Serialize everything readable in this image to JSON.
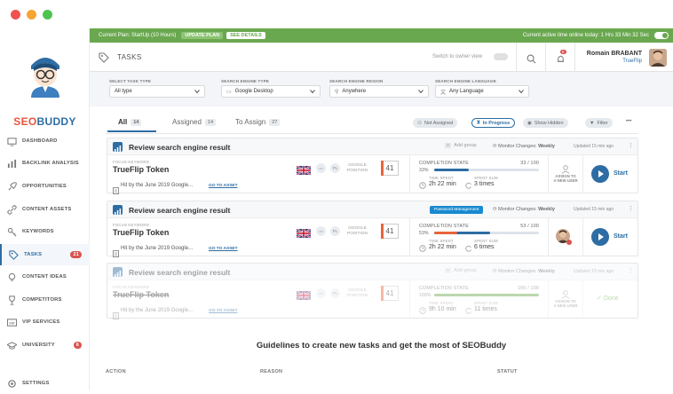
{
  "colors": {
    "accent": "#2d6da3",
    "green": "#6aa84f",
    "red": "#d9534f",
    "orange": "#e8643a"
  },
  "topbar": {
    "plan": "Current Plan: StartUp (10 Hours)",
    "update": "UPDATE PLAN",
    "details": "SEE DETAILS",
    "active": "Current active time online today: 1 Hrs 33 Min 32 Sec"
  },
  "logo": {
    "seo": "SEO",
    "buddy": "BUDDY"
  },
  "sidebar": {
    "items": [
      {
        "label": "DASHBOARD",
        "icon": "monitor-icon"
      },
      {
        "label": "BACKLINK ANALYSIS",
        "icon": "chart-icon"
      },
      {
        "label": "OPPORTUNITIES",
        "icon": "rocket-icon"
      },
      {
        "label": "CONTENT ASSETS",
        "icon": "link-icon"
      },
      {
        "label": "KEYWORDS",
        "icon": "key-icon"
      },
      {
        "label": "TASKS",
        "icon": "tag-icon",
        "badge": "21"
      },
      {
        "label": "CONTENT IDEAS",
        "icon": "bulb-icon"
      },
      {
        "label": "COMPETITORS",
        "icon": "trophy-icon"
      },
      {
        "label": "VIP SERVICES",
        "icon": "vip-icon"
      },
      {
        "label": "UNIVERSITY",
        "icon": "graduation-icon",
        "badge": "6"
      }
    ],
    "settings": "SETTINGS"
  },
  "header": {
    "title": "TASKS",
    "switch": "Switch to owner view",
    "bell_count": "5",
    "user_name": "Romain BRABANT",
    "user_company": "TrueFlip"
  },
  "filters": [
    {
      "label": "SELECT TASK TYPE",
      "value": "All type"
    },
    {
      "label": "SEARCH ENGINE TYPE",
      "value": "Google Desktop"
    },
    {
      "label": "SEARCH ENGINE REGION",
      "value": "Anywhere"
    },
    {
      "label": "SEARCH ENGINE LANGUAGE",
      "value": "Any Language"
    }
  ],
  "tabs": [
    {
      "label": "All",
      "count": "14"
    },
    {
      "label": "Assigned",
      "count": "14"
    },
    {
      "label": "To Assign",
      "count": "27"
    }
  ],
  "pills": {
    "not_assigned": "Not Assigned",
    "in_progress": "In Progress",
    "show_hidden": "Show Hidden",
    "filter": "Filter",
    "more": "•••"
  },
  "common": {
    "focus": "FOCUS KEYWORD",
    "gpos": "GOOGLE",
    "gpos2": "POSITION",
    "completion": "COMPLETION STATE",
    "time_spent": "TIME SPENT",
    "spent_sum": "SPENT SUM",
    "goto": "GO TO ASSET",
    "assign1": "ASSIGN TO",
    "assign2": "A NEW USER",
    "monitor": "Monitor Changes:",
    "weekly": "Weekly",
    "start": "Start",
    "done": "Done",
    "add_group": "Add group",
    "flag_pl": "PL"
  },
  "tasks": [
    {
      "title": "Review search engine result",
      "keyword": "TrueFlip Token",
      "hit": "Hit by the June 2019 Google...",
      "position": "41",
      "progress": "33 / 100",
      "pct": "33%",
      "pct_val": 0.33,
      "time": "2h 22 min",
      "count": "3 times",
      "updated": "Updated 15 min ago",
      "badge": ""
    },
    {
      "title": "Review search engine result",
      "keyword": "TrueFlip Token",
      "hit": "Hit by the June 2019 Google...",
      "position": "41",
      "progress": "53 / 100",
      "pct": "53%",
      "pct_val": 0.53,
      "time": "2h 22 min",
      "count": "6 times",
      "updated": "Updated 15 min ago",
      "badge": "Password Management"
    },
    {
      "title": "Review search engine result",
      "keyword": "TrueFlip Token",
      "hit": "Hit by the June 2019 Google...",
      "position": "41",
      "progress": "100 / 100",
      "pct": "100%",
      "pct_val": 1.0,
      "time": "9h 10 min",
      "count": "11 times",
      "updated": "Updated 15 min ago",
      "badge": ""
    }
  ],
  "guidelines": {
    "title": "Guidelines to create new tasks and get the most of SEOBuddy",
    "col1": "ACTION",
    "col2": "REASON",
    "col3": "STATUT"
  }
}
